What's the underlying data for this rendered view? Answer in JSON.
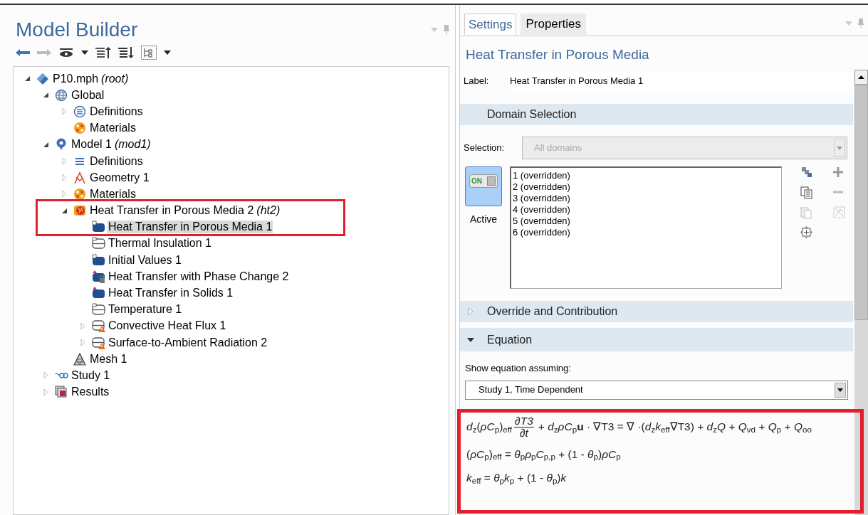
{
  "model_builder": {
    "title": "Model Builder",
    "tree": [
      {
        "label": "P10.mph",
        "suffix": "(root)",
        "kind": "file",
        "expanded": true,
        "selected": false,
        "children": [
          {
            "label": "Global",
            "kind": "globe",
            "expanded": true,
            "selected": false,
            "children": [
              {
                "label": "Definitions",
                "kind": "definitions",
                "expanded": false,
                "selected": false
              },
              {
                "label": "Materials",
                "kind": "materials",
                "selected": false
              }
            ]
          },
          {
            "label": "Model 1",
            "suffix": "(mod1)",
            "kind": "model",
            "expanded": true,
            "selected": false,
            "children": [
              {
                "label": "Definitions",
                "kind": "list",
                "expanded": false,
                "selected": false
              },
              {
                "label": "Geometry 1",
                "kind": "geometry",
                "expanded": false,
                "selected": false
              },
              {
                "label": "Materials",
                "kind": "materials",
                "expanded": false,
                "selected": false
              },
              {
                "label": "Heat Transfer in Porous Media 2",
                "suffix": "(ht2)",
                "kind": "physics",
                "expanded": true,
                "selected": false,
                "children": [
                  {
                    "label": "Heat Transfer in Porous Media 1",
                    "kind": "domain",
                    "selected": true
                  },
                  {
                    "label": "Thermal Insulation 1",
                    "kind": "boundary",
                    "selected": false
                  },
                  {
                    "label": "Initial Values 1",
                    "kind": "domain",
                    "selected": false
                  },
                  {
                    "label": "Heat Transfer with Phase Change 2",
                    "kind": "domain-locked",
                    "selected": false
                  },
                  {
                    "label": "Heat Transfer in Solids 1",
                    "kind": "domain-flagged",
                    "selected": false
                  },
                  {
                    "label": "Temperature 1",
                    "kind": "boundary",
                    "selected": false
                  },
                  {
                    "label": "Convective Heat Flux 1",
                    "kind": "boundary-warning",
                    "expanded": false,
                    "selected": false
                  },
                  {
                    "label": "Surface-to-Ambient Radiation 2",
                    "kind": "boundary-warning",
                    "expanded": false,
                    "selected": false
                  }
                ]
              },
              {
                "label": "Mesh 1",
                "kind": "mesh",
                "selected": false
              }
            ]
          },
          {
            "label": "Study 1",
            "kind": "study",
            "expanded": false,
            "selected": false
          },
          {
            "label": "Results",
            "kind": "results",
            "expanded": false,
            "selected": false
          }
        ]
      }
    ]
  },
  "settings": {
    "tabs": [
      {
        "label": "Settings",
        "selected": true
      },
      {
        "label": "Properties",
        "selected": false
      }
    ],
    "title": "Heat Transfer in Porous Media",
    "label_field": {
      "label": "Label:",
      "value": "Heat Transfer in Porous Media 1"
    },
    "domain_selection": {
      "title": "Domain Selection",
      "selection_label": "Selection:",
      "selection_value": "All domains",
      "selection_disabled": true,
      "toggle": {
        "on": true,
        "state_text": "ON",
        "label": "Active"
      },
      "items": [
        "1 (overridden)",
        "2 (overridden)",
        "3 (overridden)",
        "4 (overridden)",
        "5 (overridden)",
        "6 (overridden)"
      ]
    },
    "override_section": {
      "title": "Override and Contribution",
      "expanded": false
    },
    "equation_section": {
      "title": "Equation",
      "expanded": true,
      "show_label": "Show equation assuming:",
      "study_value": "Study 1, Time Dependent",
      "equations": [
        {
          "pre": "*d*$_{z}$(*ρC*$_{p}$)$_{eff}$",
          "frac_num": "∂T3",
          "frac_den": "∂t",
          "post": "+ *d*$_{z}$*ρC*$_{p}$**u** · ∇T3 = ∇ ·(*d*$_{z}$*k*$_{eff}$∇T3) + *d*$_{z}$*Q* + *Q*$_{vd}$ + *Q*$_{p}$ + *Q*$_{oo}$"
        },
        {
          "pre": "(*ρC*$_{p}$)$_{eff}$ = *θ*$_{p}$*ρ*$_{p}$*C*$_{p,p}$ + (1 - *θ*$_{p}$)*ρC*$_{p}$"
        },
        {
          "pre": "*k*$_{eff}$ = *θ*$_{p}$*k*$_{p}$ + (1 - *θ*$_{p}$)*k*"
        }
      ]
    }
  }
}
